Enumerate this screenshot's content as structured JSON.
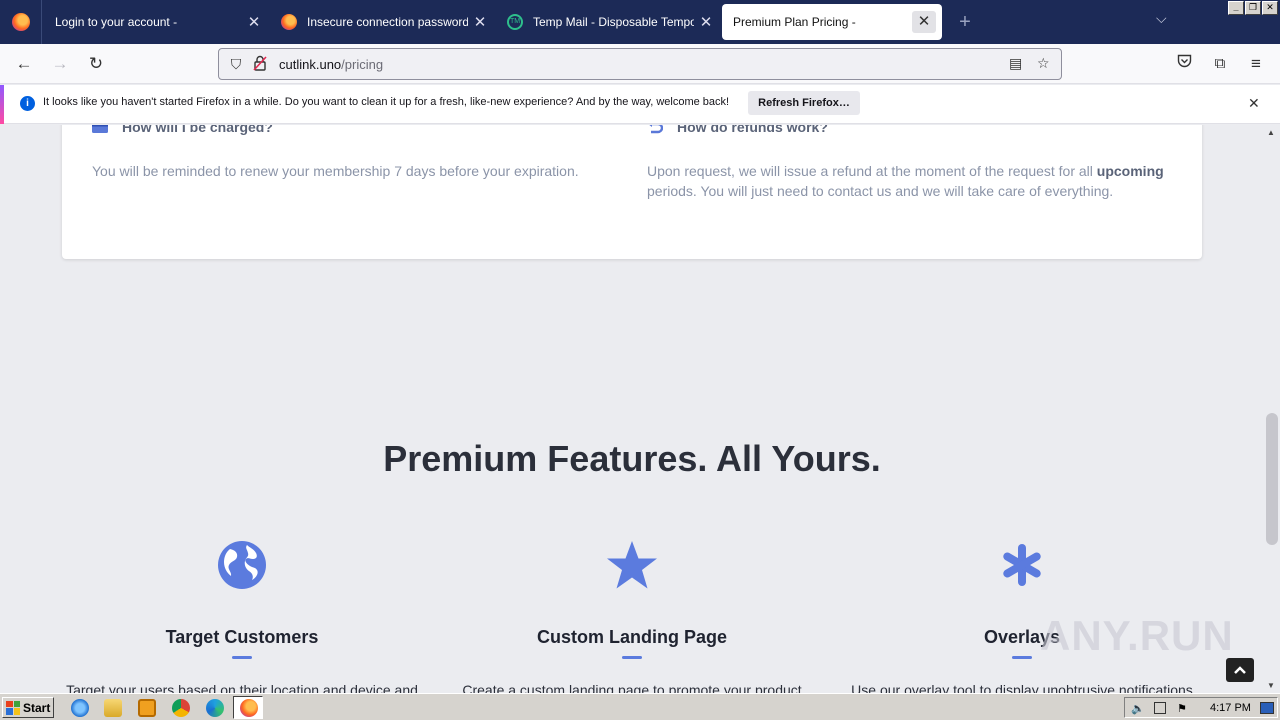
{
  "browser": {
    "tabs": [
      {
        "title": "Login to your account -",
        "favicon": "firefox-icon",
        "active": false
      },
      {
        "title": "Insecure connection password warning",
        "favicon": "firefox-icon",
        "active": false
      },
      {
        "title": "Temp Mail - Disposable Temporary Email",
        "favicon": "tempmail-icon",
        "active": false
      },
      {
        "title": "Premium Plan Pricing -",
        "favicon": "none",
        "active": true
      }
    ],
    "new_tab_glyph": "+",
    "url": {
      "host": "cutlink.uno",
      "path": "/pricing"
    }
  },
  "notification": {
    "message": "It looks like you haven't started Firefox in a while. Do you want to clean it up for a fresh, like-new experience? And by the way, welcome back!",
    "button_label": "Refresh Firefox…"
  },
  "faq": [
    {
      "question": "How will I be charged?",
      "icon": "credit-card-icon",
      "answer_before": "You will be reminded to renew your membership 7 days before your expiration.",
      "answer_bold": "",
      "answer_after": ""
    },
    {
      "question": "How do refunds work?",
      "icon": "refund-icon",
      "answer_before": "Upon request, we will issue a refund at the moment of the request for all ",
      "answer_bold": "upcoming",
      "answer_after": " periods. You will just need to contact us and we will take care of everything."
    }
  ],
  "features": {
    "title": "Premium Features. All Yours.",
    "items": [
      {
        "icon": "globe-icon",
        "title": "Target Customers",
        "description": "Target your users based on their location and device and"
      },
      {
        "icon": "star-icon",
        "title": "Custom Landing Page",
        "description": "Create a custom landing page to promote your product"
      },
      {
        "icon": "asterisk-icon",
        "title": "Overlays",
        "description": "Use our overlay tool to display unobtrusive notifications"
      }
    ]
  },
  "watermark": "ANY.RUN",
  "taskbar": {
    "start_label": "Start",
    "clock": "4:17 PM"
  },
  "colors": {
    "accent": "#5b7bde",
    "tabstrip": "#1c2a57",
    "page_bg": "#ebecf0"
  }
}
